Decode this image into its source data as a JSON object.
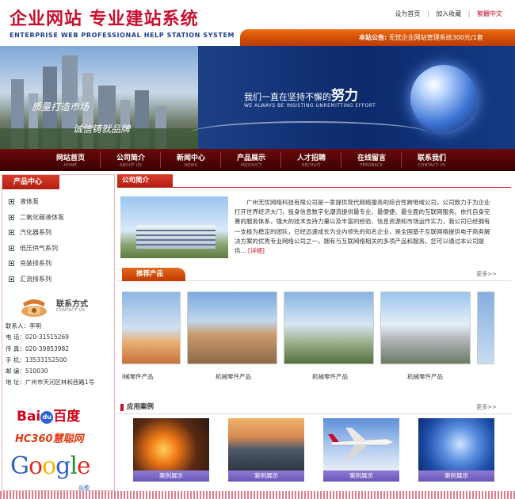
{
  "header": {
    "logo_title": "企业网站 专业建站系统",
    "logo_sub": "ENTERPRISE WEB PROFESSIONAL HELP STATION SYSTEM",
    "links": [
      "设为首页",
      "加入收藏",
      "繁體中文"
    ],
    "notice_label": "本站公告:",
    "notice_text": "无忧企业网站管理系统300元/1套"
  },
  "banner": {
    "calligraphy_1": "质量打造市场",
    "calligraphy_2": "诚信铸就品牌",
    "slogan_cn_prefix": "我们一直在坚持不懈的",
    "slogan_cn_emph": "努力",
    "slogan_en": "WE ALWAYS BE INSISTING UNREMITTING EFFORT"
  },
  "nav": {
    "items": [
      {
        "cn": "网站首页",
        "en": "HOME"
      },
      {
        "cn": "公司简介",
        "en": "ABOUT US"
      },
      {
        "cn": "新闻中心",
        "en": "NEWS"
      },
      {
        "cn": "产品展示",
        "en": "PRODUCT"
      },
      {
        "cn": "人才招聘",
        "en": "RECRUIT"
      },
      {
        "cn": "在线留言",
        "en": "FEEDBACK"
      },
      {
        "cn": "联系我们",
        "en": "CONTACT US"
      }
    ]
  },
  "sidebar": {
    "title": "产品中心",
    "items": [
      "液体泵",
      "二氧化碳液体泵",
      "汽化器系列",
      "低压供气系列",
      "充装排系列",
      "汇流排系列"
    ],
    "contact_title": "联系方式",
    "contact_sub": "CONTACT US",
    "contact_rows": [
      "联系人：李明",
      "电  话：020-31515269",
      "传  真：020-39853982",
      "手  机：13533152500",
      "邮  编：510030",
      "地  址：广州市天河区林和西路1号"
    ],
    "baidu_left": "Bai",
    "baidu_paw": "du",
    "baidu_right": "百度",
    "hc360": "HC360慧聪网",
    "google_parts": [
      "G",
      "o",
      "o",
      "g",
      "l",
      "e"
    ],
    "google_sub": "谷歌"
  },
  "about": {
    "title": "公司简介",
    "text": "广州无忧网络科技有限公司是一家提供现代网络服务的综合性跨地域公司，公司致力于为企业打开世界经济大门，投身信息数字化潮流提供最专业、最便捷、最全面的互联网服务。依托自身完善的服务体系，强大的技术支持力量以及丰富的经验、信息资源和市场运作实力，我公司已经拥有一支极为稳定的团队，已经迅速成长为业内领先的知名企业，是全国基于互联网络提供电子商务解决方案的优秀专业网络公司之一，拥有与互联网络相关的多项产品和服务。您可以通过本公司提供...",
    "detail": "[详细]"
  },
  "products": {
    "title": "推荐产品",
    "more": "更多>>",
    "names": [
      "l械零件产品",
      "机械零件产品",
      "机械零件产品",
      "机械零件产品"
    ]
  },
  "cases": {
    "title": "应用案例",
    "more": "更多>>",
    "labels": [
      "案例展示",
      "案例展示",
      "案例展示",
      "案例展示"
    ]
  }
}
